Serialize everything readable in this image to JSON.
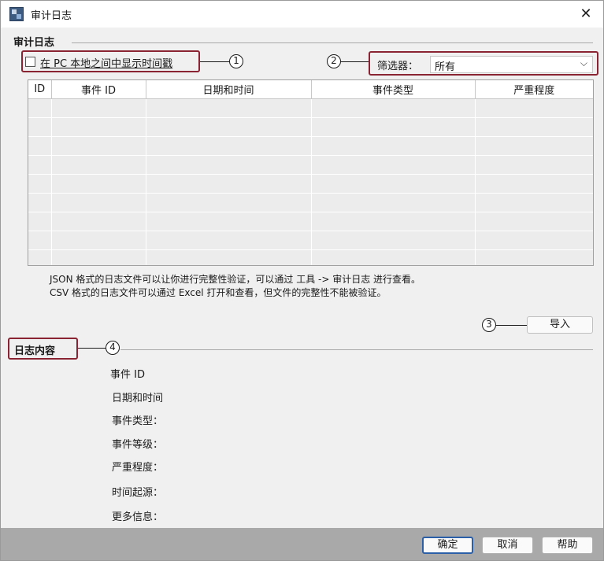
{
  "window": {
    "title": "审计日志",
    "close": "✕"
  },
  "audit_section": {
    "label": "审计日志",
    "checkbox_label": "在 PC 本地之间中显示时间戳",
    "checked": false,
    "filter_label": "筛选器：",
    "filter_value": "所有",
    "columns": [
      "ID",
      "事件 ID",
      "日期和时间",
      "事件类型",
      "严重程度"
    ],
    "info_lines": [
      "JSON 格式的日志文件可以让你进行完整性验证，可以通过 工具 -> 审计日志 进行查看。",
      "CSV 格式的日志文件可以通过 Excel 打开和查看，但文件的完整性不能被验证。"
    ],
    "import_label": "导入"
  },
  "detail_section": {
    "label": "日志内容",
    "fields": [
      "事件 ID",
      "日期和时间",
      "事件类型：",
      "事件等级：",
      "严重程度：",
      "时间起源：",
      "更多信息："
    ]
  },
  "callouts": [
    "1",
    "2",
    "3",
    "4"
  ],
  "footer": {
    "ok": "确定",
    "cancel": "取消",
    "help": "帮助"
  },
  "colors": {
    "callout_border": "#8a2332",
    "primary_border": "#2b5fa8",
    "footer_bg": "#a9a9a9"
  }
}
